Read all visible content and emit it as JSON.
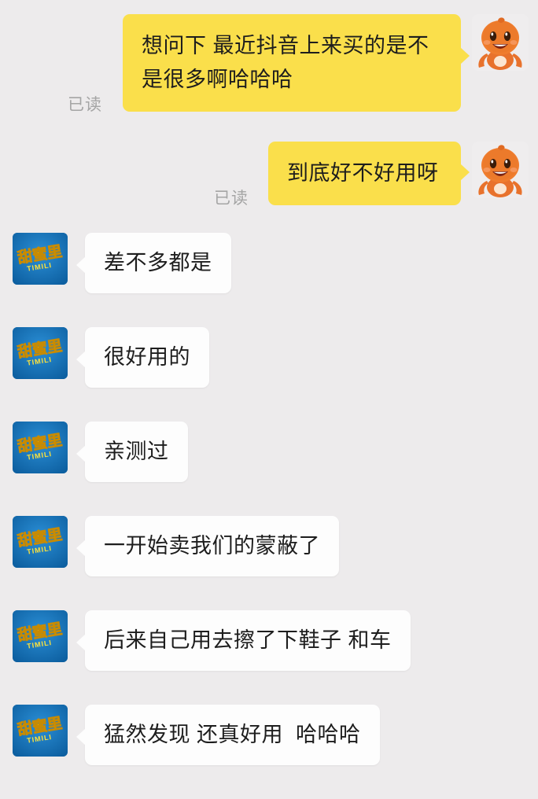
{
  "app": {
    "type": "chat-conversation",
    "background_color": "#edebec",
    "outgoing_bubble_color": "#fadf4b",
    "incoming_bubble_color": "#fdfdfd",
    "text_color": "#1d1d1d",
    "read_receipt_color": "#a5a5a5"
  },
  "avatars": {
    "self": {
      "name": "orange-character-avatar",
      "description": "orange cartoon pumpkin-head character",
      "color": "#e8722c"
    },
    "contact": {
      "name": "timili-brand-avatar",
      "logo_text": "甜蜜里",
      "logo_subtext": "TIMILI",
      "background_color": "#1169ab",
      "logo_color": "#ffe23a"
    }
  },
  "messages": [
    {
      "id": 1,
      "side": "outgoing",
      "text": "想问下 最近抖音上来买的是不\n是很多啊哈哈哈",
      "read_label": "已读"
    },
    {
      "id": 2,
      "side": "outgoing",
      "text": "到底好不好用呀",
      "read_label": "已读"
    },
    {
      "id": 3,
      "side": "incoming",
      "text": "差不多都是",
      "read_label": ""
    },
    {
      "id": 4,
      "side": "incoming",
      "text": "很好用的",
      "read_label": ""
    },
    {
      "id": 5,
      "side": "incoming",
      "text": "亲测过",
      "read_label": ""
    },
    {
      "id": 6,
      "side": "incoming",
      "text": "一开始卖我们的蒙蔽了",
      "read_label": ""
    },
    {
      "id": 7,
      "side": "incoming",
      "text": "后来自己用去擦了下鞋子 和车",
      "read_label": ""
    },
    {
      "id": 8,
      "side": "incoming",
      "text": "猛然发现 还真好用  哈哈哈",
      "read_label": ""
    }
  ]
}
